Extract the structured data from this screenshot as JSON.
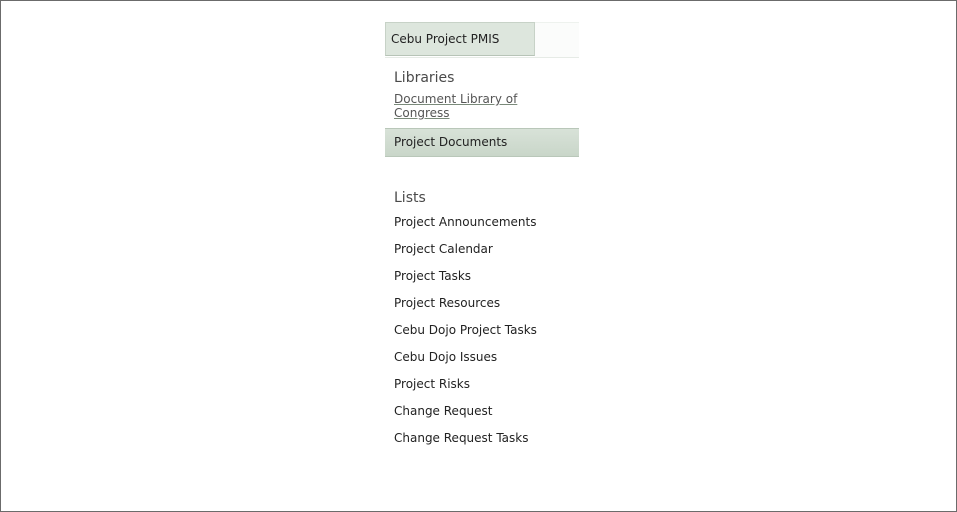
{
  "site": {
    "title": "Cebu Project PMIS"
  },
  "libraries": {
    "heading": "Libraries",
    "items": [
      {
        "label": "Document Library of Congress"
      },
      {
        "label": "Project Documents"
      }
    ]
  },
  "lists": {
    "heading": "Lists",
    "items": [
      {
        "label": "Project Announcements"
      },
      {
        "label": "Project Calendar"
      },
      {
        "label": "Project Tasks"
      },
      {
        "label": "Project Resources"
      },
      {
        "label": "Cebu Dojo Project Tasks"
      },
      {
        "label": "Cebu Dojo Issues"
      },
      {
        "label": "Project Risks"
      },
      {
        "label": "Change Request"
      },
      {
        "label": "Change Request Tasks"
      }
    ]
  },
  "colors": {
    "selected_background": "#d3ddd3",
    "text": "#222222",
    "heading": "#4a4a4a"
  }
}
